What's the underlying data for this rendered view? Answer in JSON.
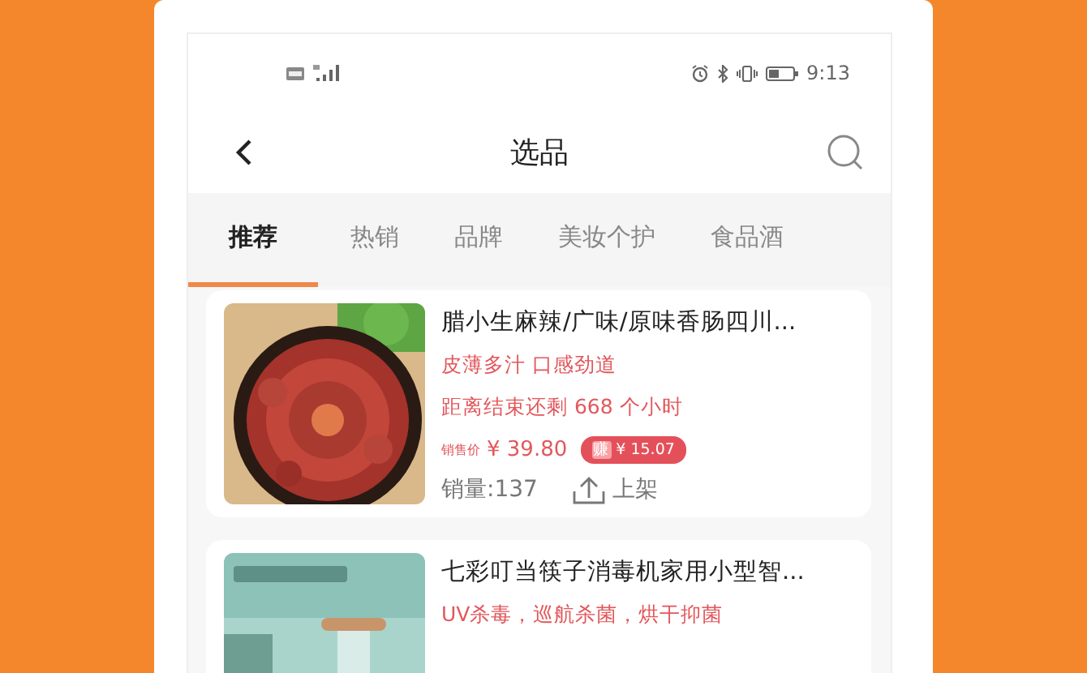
{
  "status_bar": {
    "time": "9:13"
  },
  "header": {
    "title": "选品"
  },
  "tabs": [
    {
      "label": "推荐",
      "selected": true
    },
    {
      "label": "热销",
      "selected": false
    },
    {
      "label": "品牌",
      "selected": false
    },
    {
      "label": "美妆个护",
      "selected": false
    },
    {
      "label": "食品酒",
      "selected": false
    }
  ],
  "products": [
    {
      "title": "腊小生麻辣/广味/原味香肠四川...",
      "tagline": "皮薄多汁 口感劲道",
      "countdown": "距离结束还剩 668 个小时",
      "price_label": "销售价",
      "price": "¥ 39.80",
      "earn_icon": "赚",
      "earn": "¥ 15.07",
      "sales": "销量:137",
      "action": "上架"
    },
    {
      "title": "七彩叮当筷子消毒机家用小型智...",
      "tagline": "UV杀毒，巡航杀菌，烘干抑菌"
    }
  ]
}
